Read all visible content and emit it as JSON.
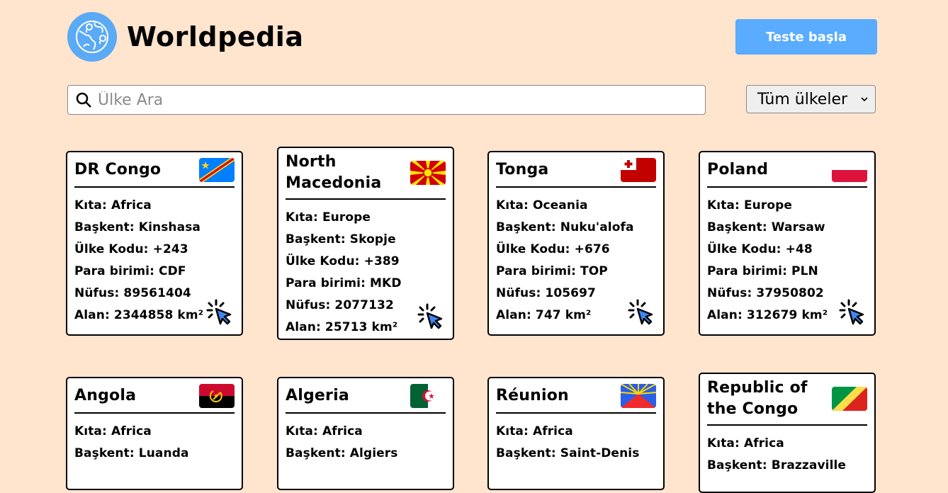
{
  "header": {
    "brand": "Worldpedia",
    "test_button": "Teste başla"
  },
  "search": {
    "placeholder": "Ülke Ara"
  },
  "filter": {
    "selected": "Tüm ülkeler"
  },
  "colors": {
    "background": "#ffe4ce",
    "accent": "#59acff"
  },
  "labels": {
    "continent": "Kıta:",
    "capital": "Başkent:",
    "code": "Ülke Kodu:",
    "currency": "Para birimi:",
    "population": "Nüfus:",
    "area": "Alan:"
  },
  "countries": [
    {
      "name": "DR Congo",
      "continent": "Africa",
      "capital": "Kinshasa",
      "code": "+243",
      "currency": "CDF",
      "population": "89561404",
      "area": "2344858 km²",
      "flag_icon": "dr-congo-flag"
    },
    {
      "name": "North Macedonia",
      "continent": "Europe",
      "capital": "Skopje",
      "code": "+389",
      "currency": "MKD",
      "population": "2077132",
      "area": "25713 km²",
      "flag_icon": "north-macedonia-flag"
    },
    {
      "name": "Tonga",
      "continent": "Oceania",
      "capital": "Nuku'alofa",
      "code": "+676",
      "currency": "TOP",
      "population": "105697",
      "area": "747 km²",
      "flag_icon": "tonga-flag"
    },
    {
      "name": "Poland",
      "continent": "Europe",
      "capital": "Warsaw",
      "code": "+48",
      "currency": "PLN",
      "population": "37950802",
      "area": "312679 km²",
      "flag_icon": "poland-flag"
    },
    {
      "name": "Angola",
      "continent": "Africa",
      "capital": "Luanda",
      "flag_icon": "angola-flag"
    },
    {
      "name": "Algeria",
      "continent": "Africa",
      "capital": "Algiers",
      "flag_icon": "algeria-flag"
    },
    {
      "name": "Réunion",
      "continent": "Africa",
      "capital": "Saint-Denis",
      "flag_icon": "reunion-flag"
    },
    {
      "name": "Republic of the Congo",
      "continent": "Africa",
      "capital": "Brazzaville",
      "flag_icon": "republic-of-congo-flag"
    }
  ]
}
